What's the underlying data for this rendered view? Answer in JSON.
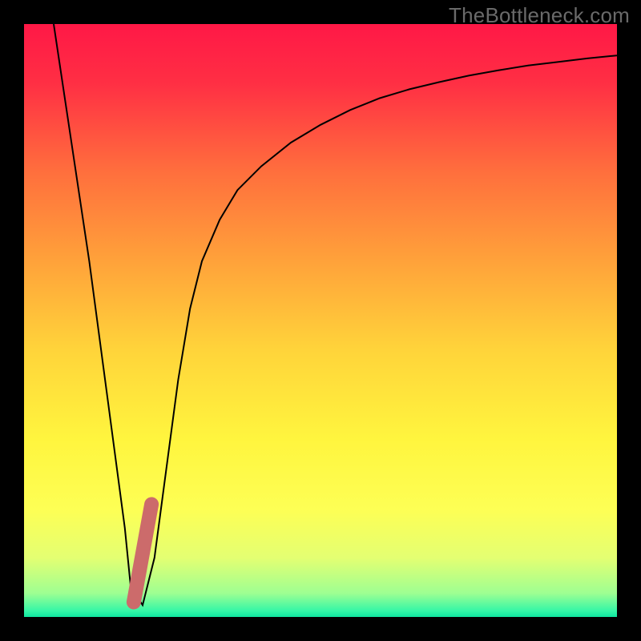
{
  "watermark": "TheBottleneck.com",
  "chart_data": {
    "type": "line",
    "title": "",
    "xlabel": "",
    "ylabel": "",
    "xlim": [
      0,
      100
    ],
    "ylim": [
      0,
      100
    ],
    "grid": false,
    "legend": false,
    "background": {
      "description": "vertical gradient red→orange→yellow→green with thin green band at bottom",
      "stops": [
        {
          "offset": 0,
          "color": "#ff1846"
        },
        {
          "offset": 10,
          "color": "#ff2f44"
        },
        {
          "offset": 25,
          "color": "#ff6f3d"
        },
        {
          "offset": 40,
          "color": "#ffa23a"
        },
        {
          "offset": 55,
          "color": "#ffd43a"
        },
        {
          "offset": 70,
          "color": "#fff53e"
        },
        {
          "offset": 82,
          "color": "#fdff55"
        },
        {
          "offset": 90,
          "color": "#e4ff72"
        },
        {
          "offset": 96,
          "color": "#9eff92"
        },
        {
          "offset": 99,
          "color": "#34f6a7"
        },
        {
          "offset": 100,
          "color": "#0fe6a0"
        }
      ]
    },
    "series": [
      {
        "name": "curve",
        "stroke": "#000000",
        "stroke_width": 2,
        "x": [
          5,
          8,
          11,
          13,
          15,
          17,
          18,
          20,
          22,
          24,
          26,
          28,
          30,
          33,
          36,
          40,
          45,
          50,
          55,
          60,
          65,
          70,
          75,
          80,
          85,
          90,
          95,
          100
        ],
        "y": [
          100,
          80,
          60,
          45,
          30,
          15,
          5,
          2,
          10,
          25,
          40,
          52,
          60,
          67,
          72,
          76,
          80,
          83,
          85.5,
          87.5,
          89,
          90.2,
          91.3,
          92.2,
          93,
          93.6,
          94.2,
          94.7
        ]
      },
      {
        "name": "marker-stroke",
        "stroke": "#cc6b6b",
        "stroke_width": 18,
        "linecap": "round",
        "x": [
          18.5,
          21.5
        ],
        "y": [
          2.5,
          19
        ]
      }
    ]
  }
}
